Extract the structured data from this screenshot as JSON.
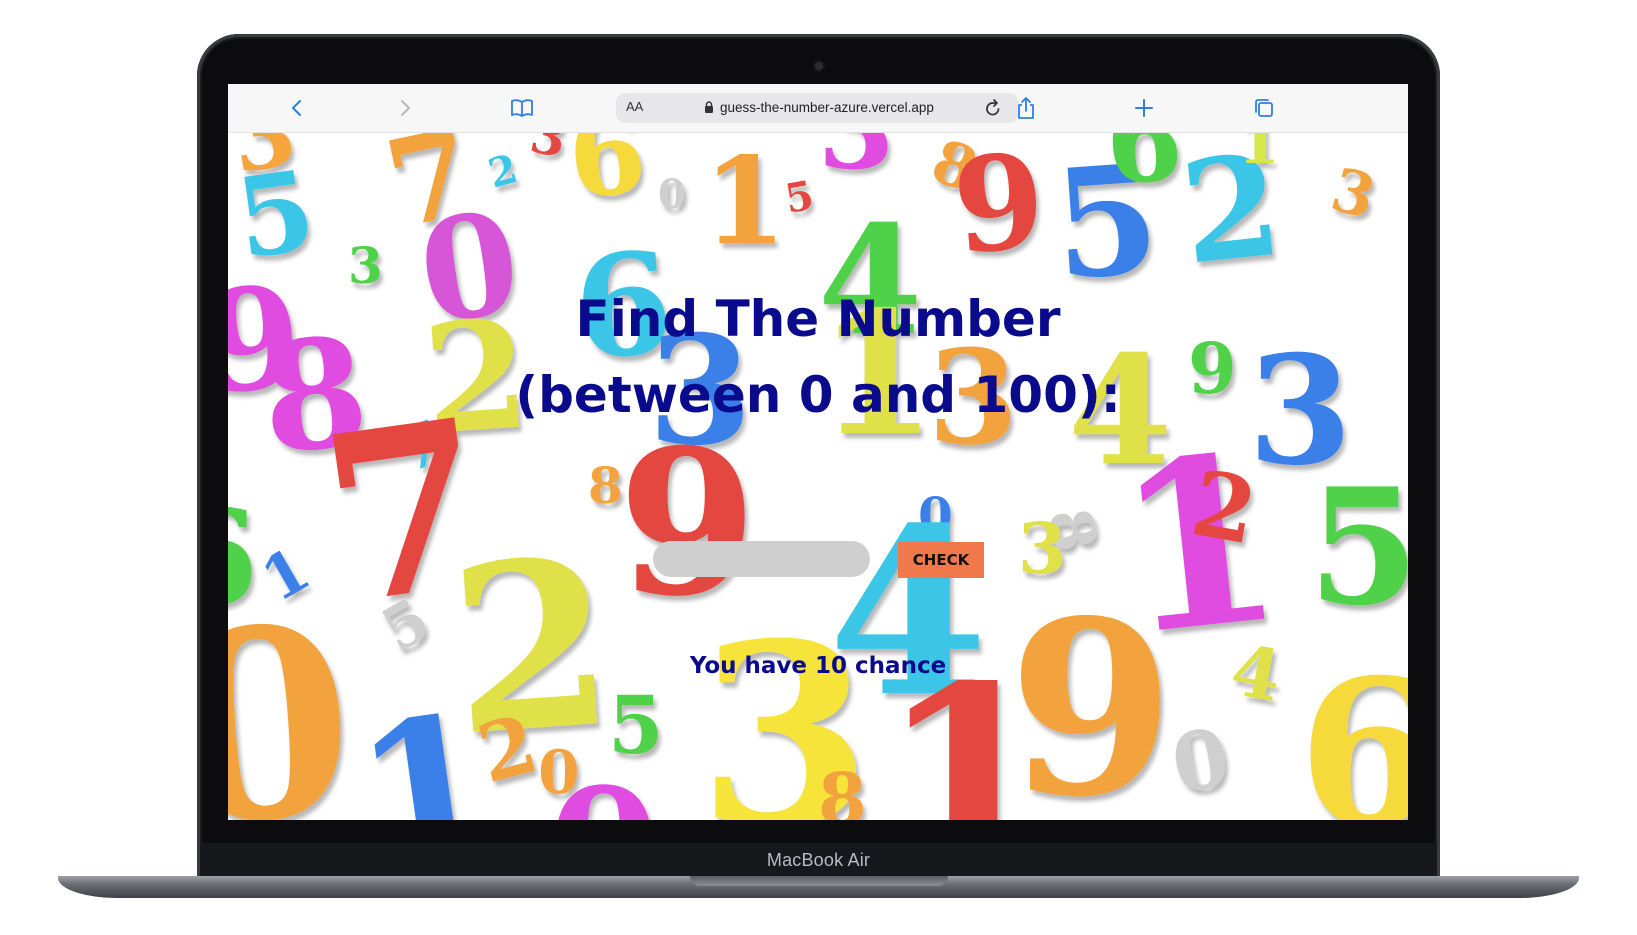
{
  "device": {
    "model_label": "MacBook Air"
  },
  "browser": {
    "text_size_label": "AA",
    "url": "guess-the-number-azure.vercel.app",
    "icons": {
      "back": "chevron-left-icon",
      "forward": "chevron-right-icon",
      "bookmarks": "book-icon",
      "lock": "lock-icon",
      "reload": "reload-icon",
      "share": "share-icon",
      "new_tab": "plus-icon",
      "tabs": "tabs-icon"
    },
    "accent_color": "#2f7fe3"
  },
  "game": {
    "title_line1": "Find The Number",
    "title_line2": "(between 0 and 100):",
    "input_value": "",
    "check_label": "CHECK",
    "status_text": "You have 10 chance",
    "colors": {
      "title": "#0a0a8c",
      "button": "#f0784a",
      "input": "#cfcfcf"
    }
  }
}
